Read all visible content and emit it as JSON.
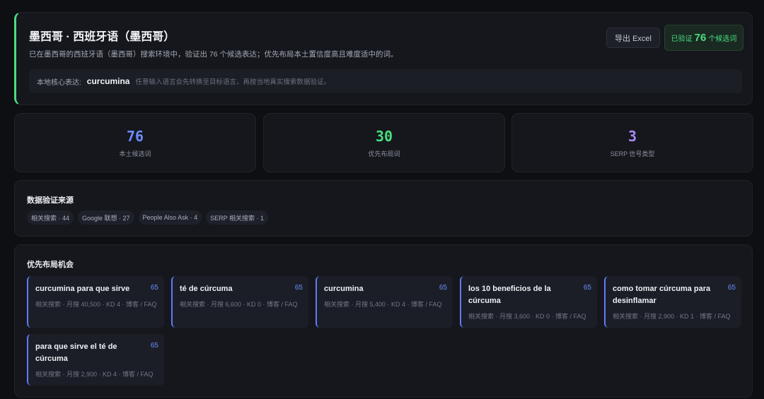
{
  "header": {
    "title": "墨西哥 · 西班牙语（墨西哥）",
    "subtitle": "已在墨西哥的西班牙语（墨西哥）搜索环境中，验证出 76 个候选表达；优先布局本土置信度高且难度适中的词。",
    "export_label": "导出 Excel",
    "verified_prefix": "已验证",
    "verified_count": "76",
    "verified_suffix": "个候选词",
    "core_label": "本地核心表达:",
    "core_keyword": "curcumina",
    "core_note": "任意输入语言会先转换至目标语言，再按当地真实搜索数据验证。"
  },
  "stats": [
    {
      "value": "76",
      "label": "本土候选词",
      "color": "#6d8cff"
    },
    {
      "value": "30",
      "label": "优先布局词",
      "color": "#4ade80"
    },
    {
      "value": "3",
      "label": "SERP 信号类型",
      "color": "#a78bfa"
    }
  ],
  "sources": {
    "title": "数据验证来源",
    "chips": [
      "相关搜索 · 44",
      "Google 联想 · 27",
      "People Also Ask · 4",
      "SERP 相关搜索 · 1"
    ]
  },
  "opportunities": {
    "title": "优先布局机会",
    "cards": [
      {
        "keyword": "curcumina para que sirve",
        "score": "65",
        "meta": "相关搜索 · 月搜 40,500 · KD 4 · 博客 / FAQ"
      },
      {
        "keyword": "té de cúrcuma",
        "score": "65",
        "meta": "相关搜索 · 月搜 6,600 · KD 0 · 博客 / FAQ"
      },
      {
        "keyword": "curcumina",
        "score": "65",
        "meta": "相关搜索 · 月搜 5,400 · KD 4 · 博客 / FAQ"
      },
      {
        "keyword": "los 10 beneficios de la cúrcuma",
        "score": "65",
        "meta": "相关搜索 · 月搜 3,600 · KD 0 · 博客 / FAQ"
      },
      {
        "keyword": "como tomar cúrcuma para desinflamar",
        "score": "65",
        "meta": "相关搜索 · 月搜 2,900 · KD 1 · 博客 / FAQ"
      },
      {
        "keyword": "para que sirve el té de cúrcuma",
        "score": "65",
        "meta": "相关搜索 · 月搜 2,900 · KD 4 · 博客 / FAQ"
      }
    ]
  }
}
